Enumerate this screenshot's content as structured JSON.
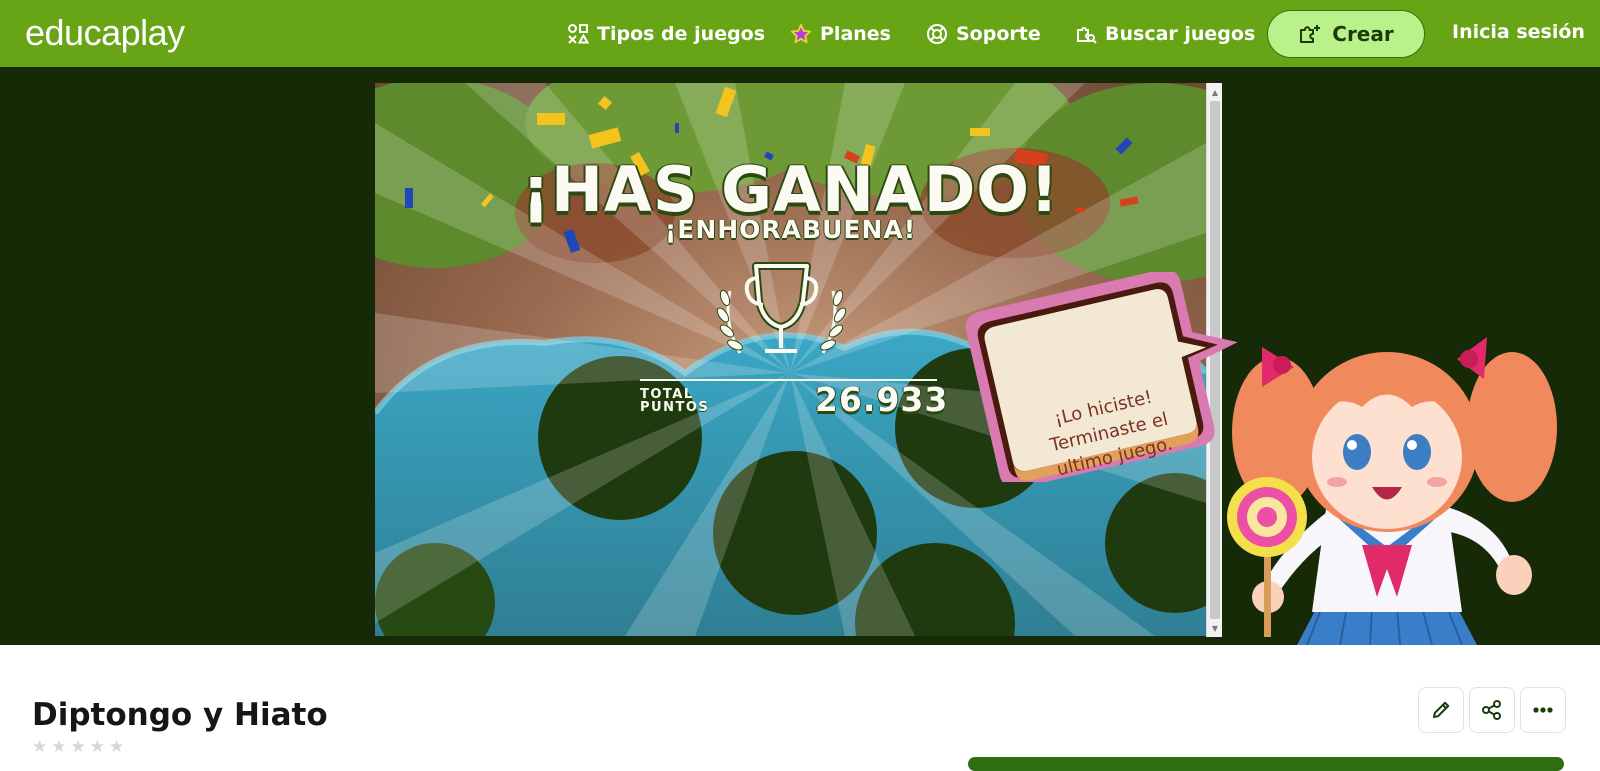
{
  "brand": {
    "logo_text": "educaplay"
  },
  "nav": {
    "items": [
      {
        "label": "Tipos de juegos",
        "icon": "shapes-icon"
      },
      {
        "label": "Planes",
        "icon": "star-icon"
      },
      {
        "label": "Soporte",
        "icon": "lifebuoy-icon"
      },
      {
        "label": "Buscar juegos",
        "icon": "search-puzzle-icon"
      }
    ],
    "create_label": "Crear",
    "login_label": "Inicia sesión"
  },
  "game": {
    "title": "¡HAS GANADO!",
    "subtitle": "¡ENHORABUENA!",
    "total_label_line1": "TOTAL",
    "total_label_line2": "PUNTOS",
    "score": "26.933",
    "speech_lines": [
      "¡Lo hiciste!",
      "Terminaste el",
      "ultimo juego."
    ]
  },
  "activity": {
    "title": "Diptongo y Hiato",
    "rating": {
      "stars": 5,
      "filled": 0
    },
    "actions": [
      {
        "icon": "pencil-icon"
      },
      {
        "icon": "share-icon"
      },
      {
        "icon": "more-icon"
      }
    ]
  },
  "colors": {
    "header_green": "#67a416",
    "stage_bg": "#172a08",
    "create_button": "#b9f28b",
    "star_icon": "#b041d8"
  }
}
